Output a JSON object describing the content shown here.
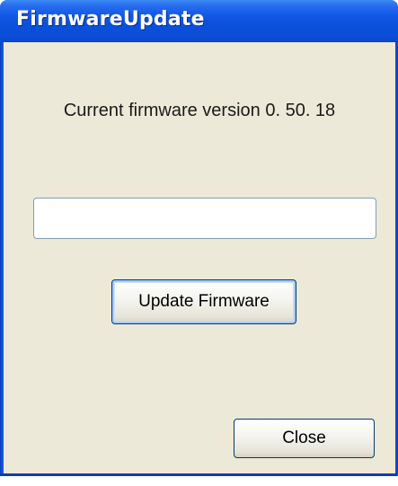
{
  "window": {
    "title": "FirmwareUpdate"
  },
  "main": {
    "version_label": "Current firmware version  0. 50. 18",
    "file_field_value": "",
    "update_button_label": "Update Firmware",
    "close_button_label": "Close"
  },
  "colors": {
    "titlebar": "#0a50dc",
    "client_background": "#ece9d8",
    "button_border": "#003c74",
    "field_border": "#7f9db9"
  }
}
